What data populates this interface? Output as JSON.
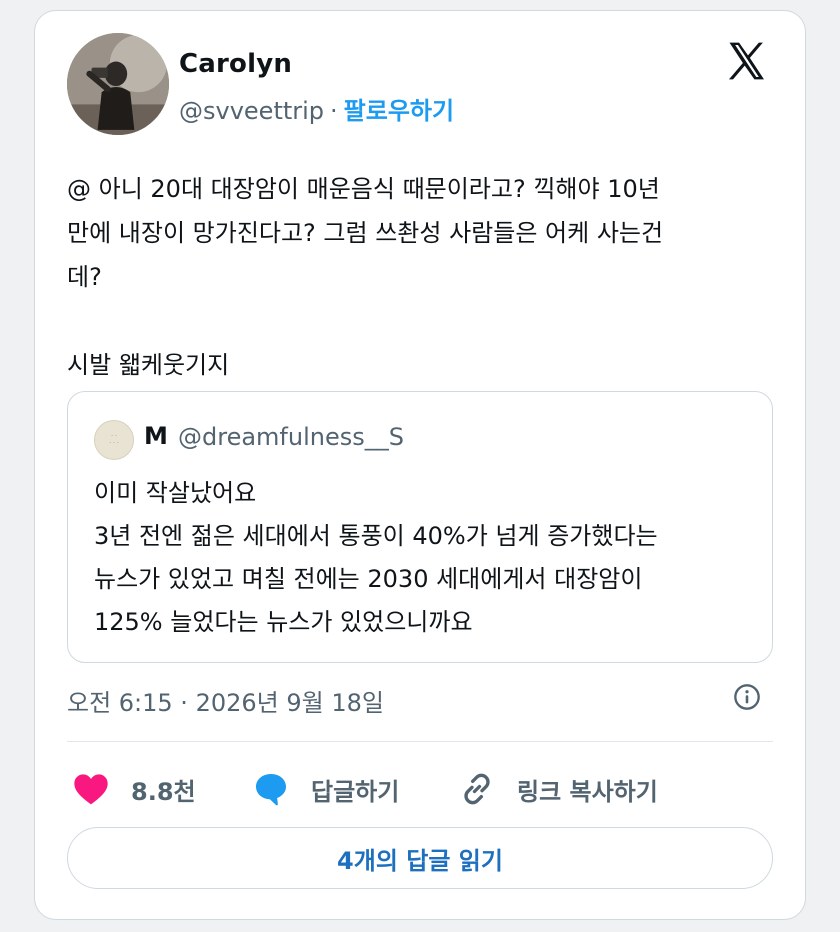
{
  "colors": {
    "accent": "#1d9bf0",
    "like": "#f91880",
    "text": "#0f1419",
    "muted": "#536471",
    "border": "#cfd9de"
  },
  "author": {
    "name": "Carolyn",
    "handle": "@svveettrip",
    "separator": "·",
    "follow_label": "팔로우하기",
    "avatar_icon": "profile-photo"
  },
  "platform_icon": "x-logo-icon",
  "tweet": {
    "line1": "@ 아니 20대 대장암이 매운음식 때문이라고? 끽해야 10년",
    "line2": "만에 내장이 망가진다고? 그럼 쓰촨성 사람들은 어케 사는건",
    "line3": "데?",
    "line4": "시발 왧케웃기지"
  },
  "quote": {
    "name": "M",
    "handle": "@dreamfulness__S",
    "line1": "이미 작살났어요",
    "line2": "3년 전엔 젊은 세대에서 통풍이 40%가 넘게 증가했다는",
    "line3": "뉴스가 있었고 며칠 전에는 2030 세대에게서 대장암이",
    "line4": "125% 늘었다는 뉴스가 있었으니까요"
  },
  "timestamp": "오전 6:15 · 2026년 9월 18일",
  "actions": {
    "like_count": "8.8천",
    "reply_label": "답글하기",
    "copy_label": "링크 복사하기"
  },
  "read_replies_label": "4개의 답글 읽기"
}
